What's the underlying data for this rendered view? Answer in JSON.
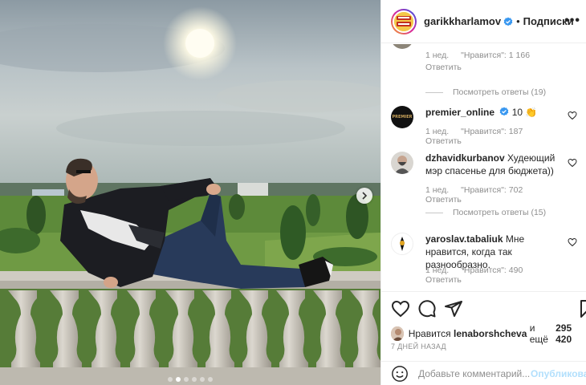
{
  "post": {
    "username": "garikkharlamov",
    "follow_label": "Подписки",
    "separator": "•",
    "more_label": "•••"
  },
  "comments": [
    {
      "meta_time": "1 нед.",
      "meta_likes": "\"Нравится\": 1 166",
      "reply_label": "Ответить",
      "view_replies": "Посмотреть ответы (19)"
    },
    {
      "username": "premier_online",
      "text": "10 👏",
      "meta_time": "1 нед.",
      "meta_likes": "\"Нравится\": 187",
      "reply_label": "Ответить"
    },
    {
      "username": "dzhavidkurbanov",
      "text": "Худеющий мэр спасенье для бюджета))",
      "meta_time": "1 нед.",
      "meta_likes": "\"Нравится\": 702",
      "reply_label": "Ответить",
      "view_replies": "Посмотреть ответы (15)"
    },
    {
      "username": "yaroslav.tabaliuk",
      "text": "Мне нравится, когда так разнообразно.",
      "meta_time": "1 нед.",
      "meta_likes": "\"Нравится\": 490",
      "reply_label": "Ответить"
    }
  ],
  "likes": {
    "prefix": "Нравится",
    "user": "lenaborshcheva",
    "middle": "и ещё",
    "count": "295 420"
  },
  "posted_ago": "7 ДНЕЙ НАЗАД",
  "add_comment": {
    "placeholder": "Добавьте комментарий...",
    "publish_label": "Опубликовать"
  },
  "premier_logo_text": "PREMIER",
  "icons": {
    "like": "heart-icon",
    "comment": "comment-icon",
    "share": "send-icon",
    "save": "bookmark-icon",
    "emoji": "emoji-icon",
    "verified": "verified-badge-icon",
    "next": "chevron-right-icon"
  },
  "colors": {
    "verified": "#3897f0",
    "publish_disabled": "#b2dffc",
    "muted_text": "#8e8e8e"
  },
  "carousel": {
    "slides": 6,
    "active_index": 1
  }
}
